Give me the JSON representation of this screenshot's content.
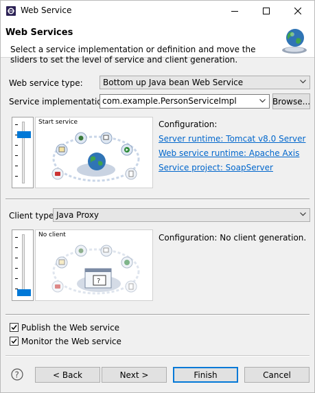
{
  "window": {
    "title": "Web Service",
    "icon": "eclipse-icon",
    "controls": [
      "minimize-icon",
      "maximize-icon",
      "close-icon"
    ]
  },
  "header": {
    "title": "Web Services",
    "description": "Select a service implementation or definition and move the sliders to set the level of service and client generation.",
    "icon": "web-services-globe-icon"
  },
  "service": {
    "type_label": "Web service type:",
    "type_value": "Bottom up Java bean Web Service",
    "impl_label": "Service implementation:",
    "impl_value": "com.example.PersonServiceImpl",
    "browse_label": "Browse...",
    "slider_caption": "Start service",
    "slider_level": 0.83,
    "config_label": "Configuration:",
    "links": [
      "Server runtime: Tomcat v8.0 Server",
      "Web service runtime: Apache Axis",
      "Service project: SoapServer"
    ]
  },
  "client": {
    "type_label": "Client type:",
    "type_value": "Java Proxy",
    "slider_caption": "No client",
    "slider_level": 0.0,
    "config_text": "Configuration: No client generation."
  },
  "options": {
    "publish_label": "Publish the Web service",
    "publish_checked": true,
    "monitor_label": "Monitor the Web service",
    "monitor_checked": true
  },
  "footer": {
    "help_icon": "help-icon",
    "back_label": "< Back",
    "next_label": "Next >",
    "finish_label": "Finish",
    "cancel_label": "Cancel"
  },
  "colors": {
    "accent": "#0078d7",
    "link": "#0066cc"
  }
}
